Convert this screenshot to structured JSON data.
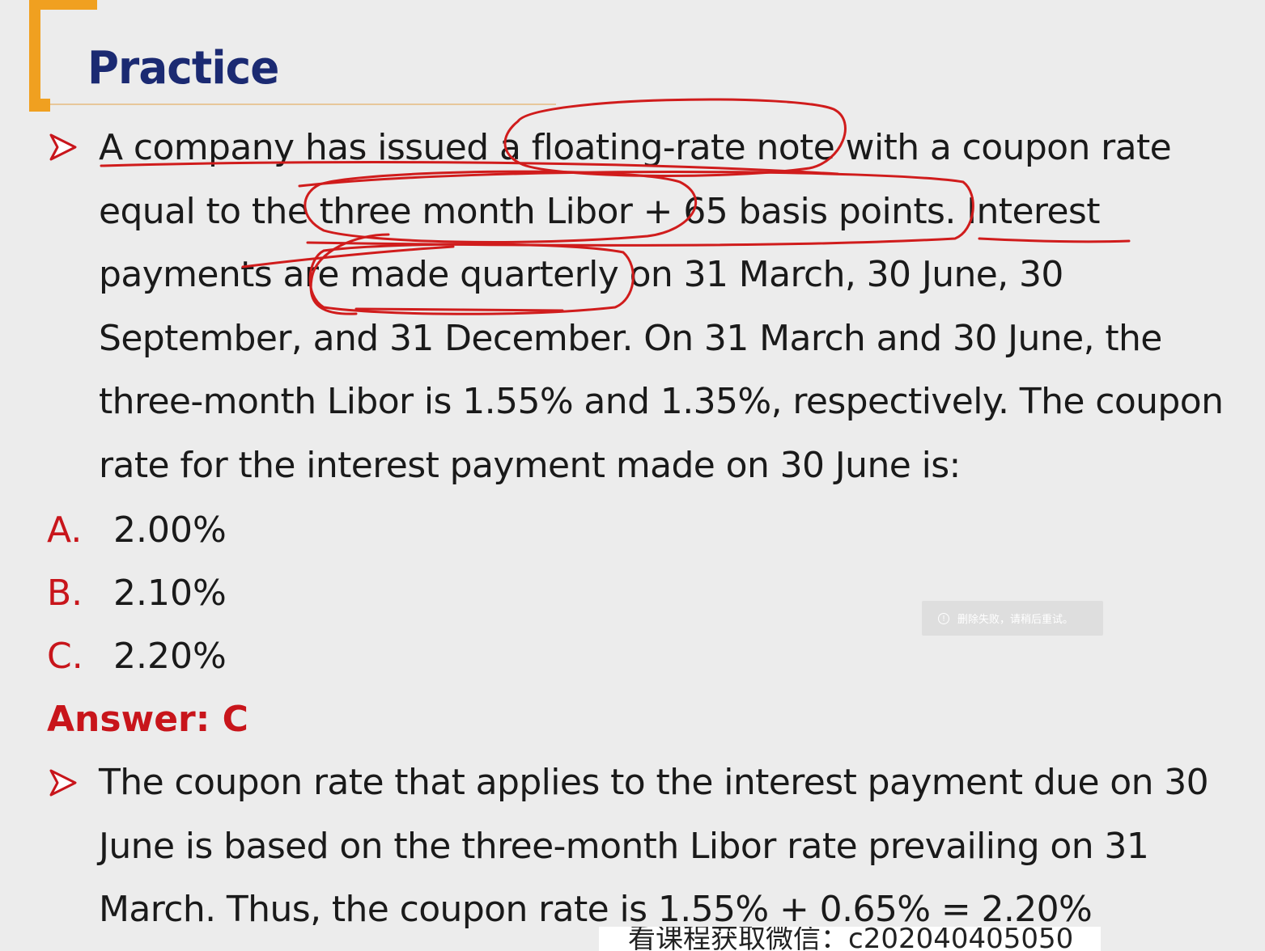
{
  "slide": {
    "title": "Practice",
    "question_lines": [
      "A company has issued a floating-rate note with a coupon rate",
      "equal to the three month Libor + 65 basis points. Interest",
      "payments are made quarterly on 31 March, 30 June, 30",
      "September, and 31 December. On 31 March and 30 June, the",
      "three-month Libor is 1.55% and 1.35%, respectively. The coupon",
      "rate for the interest payment made on 30 June is:"
    ],
    "options": [
      {
        "letter": "A.",
        "value": "2.00%"
      },
      {
        "letter": "B.",
        "value": "2.10%"
      },
      {
        "letter": "C.",
        "value": "2.20%"
      }
    ],
    "answer": "Answer: C",
    "explanation_lines": [
      "The coupon rate that applies to the interest payment due on 30",
      "June is based on the three-month Libor rate prevailing on 31",
      "March. Thus, the coupon rate is 1.55% + 0.65% = 2.20%"
    ]
  },
  "toast": {
    "icon": "info-icon",
    "text": "删除失败，请稍后重试。"
  },
  "watermark": {
    "text": "看课程获取微信：c202040405050"
  },
  "colors": {
    "title": "#1b2a72",
    "accent_orange": "#f0a020",
    "red": "#c8151b",
    "ink": "#d01c1c"
  }
}
